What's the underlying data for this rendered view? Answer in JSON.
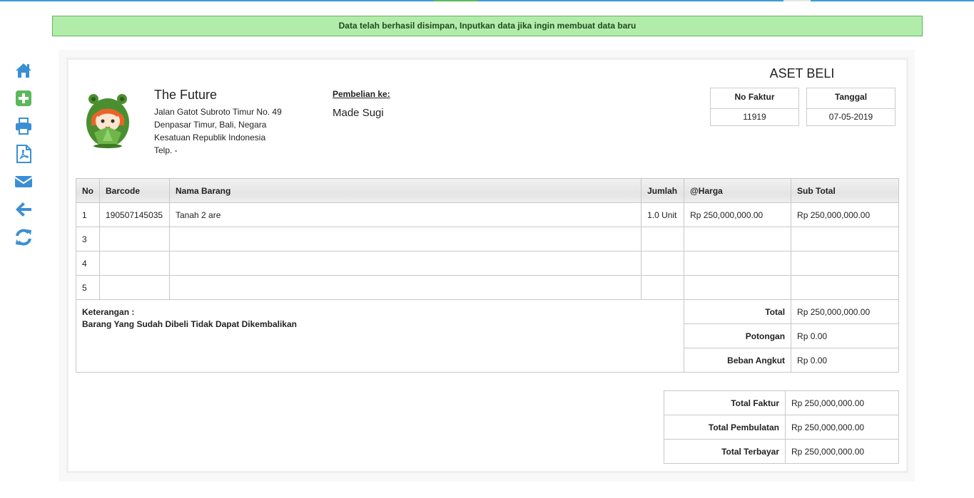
{
  "colors": {
    "accent": "#3a9ad9",
    "success_bg": "#b2ecab",
    "add_icon": "#5cb85c"
  },
  "alert": {
    "message": "Data telah berhasil disimpan, Inputkan data jika ingin membuat data baru"
  },
  "sidebar": {
    "items": [
      {
        "icon": "home-icon",
        "label": "Home"
      },
      {
        "icon": "plus-square-icon",
        "label": "Add"
      },
      {
        "icon": "print-icon",
        "label": "Print"
      },
      {
        "icon": "pdf-file-icon",
        "label": "PDF"
      },
      {
        "icon": "envelope-icon",
        "label": "Email"
      },
      {
        "icon": "arrow-left-icon",
        "label": "Back"
      },
      {
        "icon": "refresh-icon",
        "label": "Refresh"
      }
    ]
  },
  "company": {
    "name": "The Future",
    "address1": "Jalan Gatot Subroto Timur No. 49",
    "address2": "Denpasar Timur, Bali, Negara",
    "address3": "Kesatuan Republik Indonesia",
    "phone": "Telp. -"
  },
  "purchase": {
    "label": "Pembelian ke:",
    "supplier": "Made Sugi"
  },
  "document": {
    "title": "ASET BELI",
    "invoice_no_label": "No Faktur",
    "invoice_no": "11919",
    "date_label": "Tanggal",
    "date": "07-05-2019"
  },
  "items": {
    "headers": [
      "No",
      "Barcode",
      "Nama Barang",
      "Jumlah",
      "@Harga",
      "Sub Total"
    ],
    "rows": [
      [
        "1",
        "190507145035",
        "Tanah 2 are",
        "1.0 Unit",
        "Rp 250,000,000.00",
        "Rp 250,000,000.00"
      ],
      [
        "3",
        "",
        "",
        "",
        "",
        ""
      ],
      [
        "4",
        "",
        "",
        "",
        "",
        ""
      ],
      [
        "5",
        "",
        "",
        "",
        "",
        ""
      ]
    ]
  },
  "summary": {
    "note_label": "Keterangan :",
    "note_text": "Barang Yang Sudah Dibeli Tidak Dapat Dikembalikan",
    "total_label": "Total",
    "total": "Rp 250,000,000.00",
    "discount_label": "Potongan",
    "discount": "Rp 0.00",
    "shipping_label": "Beban Angkut",
    "shipping": "Rp 0.00"
  },
  "totals": {
    "invoice_total_label": "Total Faktur",
    "invoice_total": "Rp 250,000,000.00",
    "rounding_label": "Total Pembulatan",
    "rounding": "Rp 250,000,000.00",
    "paid_label": "Total Terbayar",
    "paid": "Rp 250,000,000.00"
  }
}
